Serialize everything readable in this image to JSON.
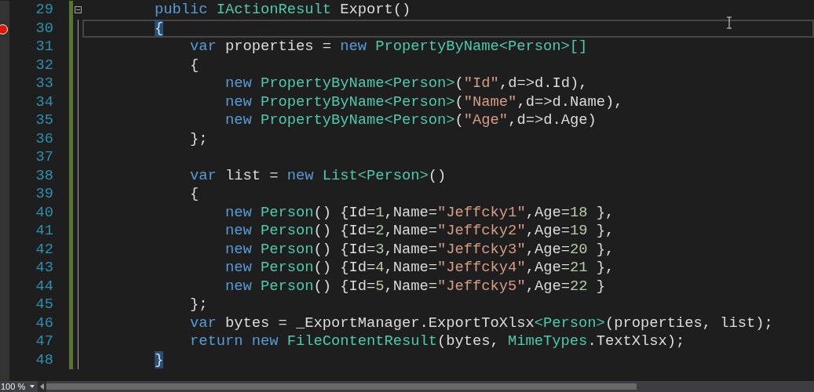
{
  "lines": [
    {
      "number": "29",
      "breakpoint": false,
      "current": false,
      "fold": true,
      "tokens": [
        {
          "kind": "kw",
          "text": "        public "
        },
        {
          "kind": "type",
          "text": "IActionResult"
        },
        {
          "kind": "plain",
          "text": " Export()"
        }
      ]
    },
    {
      "number": "30",
      "breakpoint": true,
      "current": true,
      "fold": false,
      "tokens": [
        {
          "kind": "match",
          "text": "        {"
        }
      ]
    },
    {
      "number": "31",
      "breakpoint": false,
      "current": false,
      "fold": false,
      "tokens": [
        {
          "kind": "kw",
          "text": "            var"
        },
        {
          "kind": "plain",
          "text": " properties = "
        },
        {
          "kind": "kw",
          "text": "new "
        },
        {
          "kind": "type",
          "text": "PropertyByName<Person>[]"
        }
      ]
    },
    {
      "number": "32",
      "breakpoint": false,
      "current": false,
      "fold": false,
      "tokens": [
        {
          "kind": "plain",
          "text": "            {"
        }
      ]
    },
    {
      "number": "33",
      "breakpoint": false,
      "current": false,
      "fold": false,
      "tokens": [
        {
          "kind": "kw",
          "text": "                new "
        },
        {
          "kind": "type",
          "text": "PropertyByName<Person>"
        },
        {
          "kind": "plain",
          "text": "("
        },
        {
          "kind": "str",
          "text": "\"Id\""
        },
        {
          "kind": "plain",
          "text": ",d=>d.Id),"
        }
      ]
    },
    {
      "number": "34",
      "breakpoint": false,
      "current": false,
      "fold": false,
      "tokens": [
        {
          "kind": "kw",
          "text": "                new "
        },
        {
          "kind": "type",
          "text": "PropertyByName<Person>"
        },
        {
          "kind": "plain",
          "text": "("
        },
        {
          "kind": "str",
          "text": "\"Name\""
        },
        {
          "kind": "plain",
          "text": ",d=>d.Name),"
        }
      ]
    },
    {
      "number": "35",
      "breakpoint": false,
      "current": false,
      "fold": false,
      "tokens": [
        {
          "kind": "kw",
          "text": "                new "
        },
        {
          "kind": "type",
          "text": "PropertyByName<Person>"
        },
        {
          "kind": "plain",
          "text": "("
        },
        {
          "kind": "str",
          "text": "\"Age\""
        },
        {
          "kind": "plain",
          "text": ",d=>d.Age)"
        }
      ]
    },
    {
      "number": "36",
      "breakpoint": false,
      "current": false,
      "fold": false,
      "tokens": [
        {
          "kind": "plain",
          "text": "            };"
        }
      ]
    },
    {
      "number": "37",
      "breakpoint": false,
      "current": false,
      "fold": false
    },
    {
      "number": "38",
      "breakpoint": false,
      "current": false,
      "fold": false,
      "tokens": [
        {
          "kind": "kw",
          "text": "            var"
        },
        {
          "kind": "plain",
          "text": " list = "
        },
        {
          "kind": "kw",
          "text": "new "
        },
        {
          "kind": "type",
          "text": "List<Person>"
        },
        {
          "kind": "plain",
          "text": "()"
        }
      ]
    },
    {
      "number": "39",
      "breakpoint": false,
      "current": false,
      "fold": false,
      "tokens": [
        {
          "kind": "plain",
          "text": "            {"
        }
      ]
    },
    {
      "number": "40",
      "breakpoint": false,
      "current": false,
      "fold": false,
      "tokens": [
        {
          "kind": "kw",
          "text": "                new "
        },
        {
          "kind": "type",
          "text": "Person"
        },
        {
          "kind": "plain",
          "text": "() {Id="
        },
        {
          "kind": "num",
          "text": "1"
        },
        {
          "kind": "plain",
          "text": ",Name="
        },
        {
          "kind": "str",
          "text": "\"Jeffcky1\""
        },
        {
          "kind": "plain",
          "text": ",Age="
        },
        {
          "kind": "num",
          "text": "18"
        },
        {
          "kind": "plain",
          "text": " },"
        }
      ]
    },
    {
      "number": "41",
      "breakpoint": false,
      "current": false,
      "fold": false,
      "tokens": [
        {
          "kind": "kw",
          "text": "                new "
        },
        {
          "kind": "type",
          "text": "Person"
        },
        {
          "kind": "plain",
          "text": "() {Id="
        },
        {
          "kind": "num",
          "text": "2"
        },
        {
          "kind": "plain",
          "text": ",Name="
        },
        {
          "kind": "str",
          "text": "\"Jeffcky2\""
        },
        {
          "kind": "plain",
          "text": ",Age="
        },
        {
          "kind": "num",
          "text": "19"
        },
        {
          "kind": "plain",
          "text": " },"
        }
      ]
    },
    {
      "number": "42",
      "breakpoint": false,
      "current": false,
      "fold": false,
      "tokens": [
        {
          "kind": "kw",
          "text": "                new "
        },
        {
          "kind": "type",
          "text": "Person"
        },
        {
          "kind": "plain",
          "text": "() {Id="
        },
        {
          "kind": "num",
          "text": "3"
        },
        {
          "kind": "plain",
          "text": ",Name="
        },
        {
          "kind": "str",
          "text": "\"Jeffcky3\""
        },
        {
          "kind": "plain",
          "text": ",Age="
        },
        {
          "kind": "num",
          "text": "20"
        },
        {
          "kind": "plain",
          "text": " },"
        }
      ]
    },
    {
      "number": "43",
      "breakpoint": false,
      "current": false,
      "fold": false,
      "tokens": [
        {
          "kind": "kw",
          "text": "                new "
        },
        {
          "kind": "type",
          "text": "Person"
        },
        {
          "kind": "plain",
          "text": "() {Id="
        },
        {
          "kind": "num",
          "text": "4"
        },
        {
          "kind": "plain",
          "text": ",Name="
        },
        {
          "kind": "str",
          "text": "\"Jeffcky4\""
        },
        {
          "kind": "plain",
          "text": ",Age="
        },
        {
          "kind": "num",
          "text": "21"
        },
        {
          "kind": "plain",
          "text": " },"
        }
      ]
    },
    {
      "number": "44",
      "breakpoint": false,
      "current": false,
      "fold": false,
      "tokens": [
        {
          "kind": "kw",
          "text": "                new "
        },
        {
          "kind": "type",
          "text": "Person"
        },
        {
          "kind": "plain",
          "text": "() {Id="
        },
        {
          "kind": "num",
          "text": "5"
        },
        {
          "kind": "plain",
          "text": ",Name="
        },
        {
          "kind": "str",
          "text": "\"Jeffcky5\""
        },
        {
          "kind": "plain",
          "text": ",Age="
        },
        {
          "kind": "num",
          "text": "22"
        },
        {
          "kind": "plain",
          "text": " }"
        }
      ]
    },
    {
      "number": "45",
      "breakpoint": false,
      "current": false,
      "fold": false,
      "tokens": [
        {
          "kind": "plain",
          "text": "            };"
        }
      ]
    },
    {
      "number": "46",
      "breakpoint": false,
      "current": false,
      "fold": false,
      "tokens": [
        {
          "kind": "kw",
          "text": "            var"
        },
        {
          "kind": "plain",
          "text": " bytes = _ExportManager.ExportToXlsx"
        },
        {
          "kind": "type",
          "text": "<Person>"
        },
        {
          "kind": "plain",
          "text": "(properties, list);"
        }
      ]
    },
    {
      "number": "47",
      "breakpoint": false,
      "current": false,
      "fold": false,
      "tokens": [
        {
          "kind": "kw",
          "text": "            return new "
        },
        {
          "kind": "type",
          "text": "FileContentResult"
        },
        {
          "kind": "plain",
          "text": "(bytes, "
        },
        {
          "kind": "type",
          "text": "MimeTypes"
        },
        {
          "kind": "plain",
          "text": ".TextXlsx);"
        }
      ]
    },
    {
      "number": "48",
      "breakpoint": false,
      "current": false,
      "fold": false,
      "tokens": [
        {
          "kind": "match",
          "text": "        }"
        }
      ]
    }
  ],
  "status_bar": {
    "zoom": "100 %"
  }
}
